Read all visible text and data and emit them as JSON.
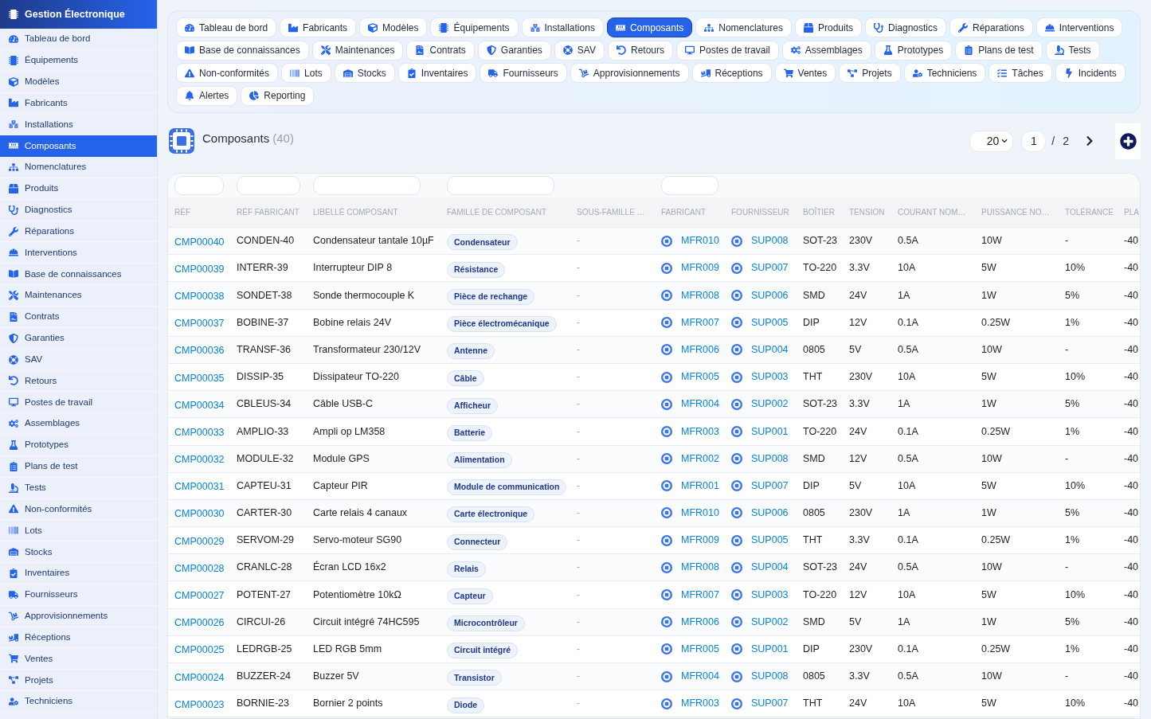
{
  "sidebar": {
    "title": "Gestion Électronique",
    "items": [
      {
        "label": "Tableau de bord",
        "selected": false
      },
      {
        "label": "Équipements",
        "selected": false
      },
      {
        "label": "Modèles",
        "selected": false
      },
      {
        "label": "Fabricants",
        "selected": false
      },
      {
        "label": "Installations",
        "selected": false
      },
      {
        "label": "Composants",
        "selected": true
      },
      {
        "label": "Nomenclatures",
        "selected": false
      },
      {
        "label": "Produits",
        "selected": false
      },
      {
        "label": "Diagnostics",
        "selected": false
      },
      {
        "label": "Réparations",
        "selected": false
      },
      {
        "label": "Interventions",
        "selected": false
      },
      {
        "label": "Base de connaissances",
        "selected": false
      },
      {
        "label": "Maintenances",
        "selected": false
      },
      {
        "label": "Contrats",
        "selected": false
      },
      {
        "label": "Garanties",
        "selected": false
      },
      {
        "label": "SAV",
        "selected": false
      },
      {
        "label": "Retours",
        "selected": false
      },
      {
        "label": "Postes de travail",
        "selected": false
      },
      {
        "label": "Assemblages",
        "selected": false
      },
      {
        "label": "Prototypes",
        "selected": false
      },
      {
        "label": "Plans de test",
        "selected": false
      },
      {
        "label": "Tests",
        "selected": false
      },
      {
        "label": "Non-conformités",
        "selected": false
      },
      {
        "label": "Lots",
        "selected": false
      },
      {
        "label": "Stocks",
        "selected": false
      },
      {
        "label": "Inventaires",
        "selected": false
      },
      {
        "label": "Fournisseurs",
        "selected": false
      },
      {
        "label": "Approvisionnements",
        "selected": false
      },
      {
        "label": "Réceptions",
        "selected": false
      },
      {
        "label": "Ventes",
        "selected": false
      },
      {
        "label": "Projets",
        "selected": false
      },
      {
        "label": "Techniciens",
        "selected": false
      }
    ]
  },
  "tab_rows": [
    [
      {
        "label": "Tableau de bord",
        "selected": false
      },
      {
        "label": "Fabricants",
        "selected": false
      },
      {
        "label": "Modèles",
        "selected": false
      },
      {
        "label": "Équipements",
        "selected": false
      },
      {
        "label": "Installations",
        "selected": false
      },
      {
        "label": "Composants",
        "selected": true
      },
      {
        "label": "Nomenclatures",
        "selected": false
      },
      {
        "label": "Produits",
        "selected": false
      },
      {
        "label": "Diagnostics",
        "selected": false
      },
      {
        "label": "Réparations",
        "selected": false
      },
      {
        "label": "Interventions",
        "selected": false
      }
    ],
    [
      {
        "label": "Base de connaissances",
        "selected": false
      },
      {
        "label": "Maintenances",
        "selected": false
      },
      {
        "label": "Contrats",
        "selected": false
      },
      {
        "label": "Garanties",
        "selected": false
      },
      {
        "label": "SAV",
        "selected": false
      },
      {
        "label": "Retours",
        "selected": false
      },
      {
        "label": "Postes de travail",
        "selected": false
      },
      {
        "label": "Assemblages",
        "selected": false
      },
      {
        "label": "Prototypes",
        "selected": false
      },
      {
        "label": "Plans de test",
        "selected": false
      },
      {
        "label": "Tests",
        "selected": false
      }
    ],
    [
      {
        "label": "Non-conformités",
        "selected": false
      },
      {
        "label": "Lots",
        "selected": false
      },
      {
        "label": "Stocks",
        "selected": false
      },
      {
        "label": "Inventaires",
        "selected": false
      },
      {
        "label": "Fournisseurs",
        "selected": false
      },
      {
        "label": "Approvisionnements",
        "selected": false
      },
      {
        "label": "Réceptions",
        "selected": false
      },
      {
        "label": "Ventes",
        "selected": false
      },
      {
        "label": "Projets",
        "selected": false
      },
      {
        "label": "Techniciens",
        "selected": false
      },
      {
        "label": "Tâches",
        "selected": false
      },
      {
        "label": "Incidents",
        "selected": false
      }
    ],
    [
      {
        "label": "Alertes",
        "selected": false
      },
      {
        "label": "Reporting",
        "selected": false
      }
    ]
  ],
  "list_header": {
    "title": "Composants",
    "count": "(40)",
    "page_size": "20",
    "page": "1",
    "separator": "/",
    "page_count": "2"
  },
  "table": {
    "columns": [
      {
        "label": "RÉF",
        "kind": "link",
        "filter": true
      },
      {
        "label": "RÉF FABRICANT",
        "kind": "text",
        "filter": true
      },
      {
        "label": "LIBELLÉ COMPOSANT",
        "kind": "text",
        "filter": true
      },
      {
        "label": "FAMILLE DE COMPOSANT",
        "kind": "badge",
        "filter": true
      },
      {
        "label": "SOUS-FAMILLE …",
        "kind": "muted",
        "filter": false
      },
      {
        "label": "FABRICANT",
        "kind": "icon_link",
        "filter": true
      },
      {
        "label": "FOURNISSEUR",
        "kind": "icon_link",
        "filter": false
      },
      {
        "label": "BOÎTIER",
        "kind": "text",
        "filter": false
      },
      {
        "label": "TENSION",
        "kind": "text",
        "filter": false
      },
      {
        "label": "COURANT NOM…",
        "kind": "text",
        "filter": false
      },
      {
        "label": "PUISSANCE NO…",
        "kind": "text",
        "filter": false
      },
      {
        "label": "TOLÉRANCE",
        "kind": "text",
        "filter": false
      },
      {
        "label": "PLA",
        "kind": "text",
        "filter": false
      }
    ],
    "rows": [
      [
        "CMP00040",
        "CONDEN-40",
        "Condensateur tantale 10µF",
        "Condensateur",
        "-",
        "MFR010",
        "SUP008",
        "SOT-23",
        "230V",
        "0.5A",
        "10W",
        "-",
        "-40"
      ],
      [
        "CMP00039",
        "INTERR-39",
        "Interrupteur DIP 8",
        "Résistance",
        "-",
        "MFR009",
        "SUP007",
        "TO-220",
        "3.3V",
        "10A",
        "5W",
        "10%",
        "-40"
      ],
      [
        "CMP00038",
        "SONDET-38",
        "Sonde thermocouple K",
        "Pièce de rechange",
        "-",
        "MFR008",
        "SUP006",
        "SMD",
        "24V",
        "1A",
        "1W",
        "5%",
        "-40"
      ],
      [
        "CMP00037",
        "BOBINE-37",
        "Bobine relais 24V",
        "Pièce électromécanique",
        "-",
        "MFR007",
        "SUP005",
        "DIP",
        "12V",
        "0.1A",
        "0.25W",
        "1%",
        "-40"
      ],
      [
        "CMP00036",
        "TRANSF-36",
        "Transformateur 230/12V",
        "Antenne",
        "-",
        "MFR006",
        "SUP004",
        "0805",
        "5V",
        "0.5A",
        "10W",
        "-",
        "-40"
      ],
      [
        "CMP00035",
        "DISSIP-35",
        "Dissipateur TO-220",
        "Câble",
        "-",
        "MFR005",
        "SUP003",
        "THT",
        "230V",
        "10A",
        "5W",
        "10%",
        "-40"
      ],
      [
        "CMP00034",
        "CBLEUS-34",
        "Câble USB-C",
        "Afficheur",
        "-",
        "MFR004",
        "SUP002",
        "SOT-23",
        "3.3V",
        "1A",
        "1W",
        "5%",
        "-40"
      ],
      [
        "CMP00033",
        "AMPLIO-33",
        "Ampli op LM358",
        "Batterie",
        "-",
        "MFR003",
        "SUP001",
        "TO-220",
        "24V",
        "0.1A",
        "0.25W",
        "1%",
        "-40"
      ],
      [
        "CMP00032",
        "MODULE-32",
        "Module GPS",
        "Alimentation",
        "-",
        "MFR002",
        "SUP008",
        "SMD",
        "12V",
        "0.5A",
        "10W",
        "-",
        "-40"
      ],
      [
        "CMP00031",
        "CAPTEU-31",
        "Capteur PIR",
        "Module de communication",
        "-",
        "MFR001",
        "SUP007",
        "DIP",
        "5V",
        "10A",
        "5W",
        "10%",
        "-40"
      ],
      [
        "CMP00030",
        "CARTER-30",
        "Carte relais 4 canaux",
        "Carte électronique",
        "-",
        "MFR010",
        "SUP006",
        "0805",
        "230V",
        "1A",
        "1W",
        "5%",
        "-40"
      ],
      [
        "CMP00029",
        "SERVOM-29",
        "Servo-moteur SG90",
        "Connecteur",
        "-",
        "MFR009",
        "SUP005",
        "THT",
        "3.3V",
        "0.1A",
        "0.25W",
        "1%",
        "-40"
      ],
      [
        "CMP00028",
        "CRANLC-28",
        "Écran LCD 16x2",
        "Relais",
        "-",
        "MFR008",
        "SUP004",
        "SOT-23",
        "24V",
        "0.5A",
        "10W",
        "-",
        "-40"
      ],
      [
        "CMP00027",
        "POTENT-27",
        "Potentiomètre 10kΩ",
        "Capteur",
        "-",
        "MFR007",
        "SUP003",
        "TO-220",
        "12V",
        "10A",
        "5W",
        "10%",
        "-40"
      ],
      [
        "CMP00026",
        "CIRCUI-26",
        "Circuit intégré 74HC595",
        "Microcontrôleur",
        "-",
        "MFR006",
        "SUP002",
        "SMD",
        "5V",
        "1A",
        "1W",
        "5%",
        "-40"
      ],
      [
        "CMP00025",
        "LEDRGB-25",
        "LED RGB 5mm",
        "Circuit intégré",
        "-",
        "MFR005",
        "SUP001",
        "DIP",
        "230V",
        "0.1A",
        "0.25W",
        "1%",
        "-40"
      ],
      [
        "CMP00024",
        "BUZZER-24",
        "Buzzer 5V",
        "Transistor",
        "-",
        "MFR004",
        "SUP008",
        "0805",
        "3.3V",
        "0.5A",
        "10W",
        "-",
        "-40"
      ],
      [
        "CMP00023",
        "BORNIE-23",
        "Bornier 2 points",
        "Diode",
        "-",
        "MFR003",
        "SUP007",
        "THT",
        "24V",
        "10A",
        "5W",
        "10%",
        "-40"
      ]
    ]
  }
}
